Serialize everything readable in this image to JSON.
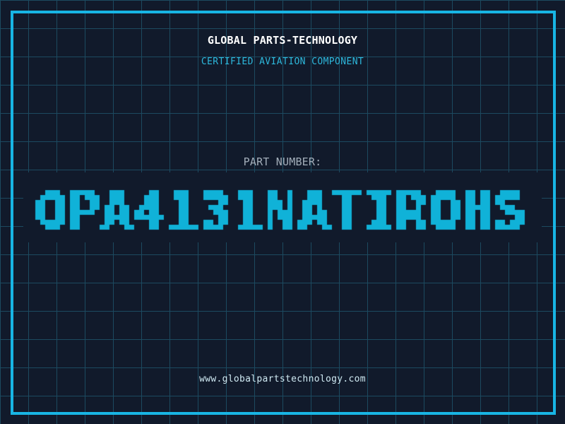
{
  "colors": {
    "background": "#111a2b",
    "grid_line": "#1c4a60",
    "frame": "#18b5e4",
    "title": "#ffffff",
    "subtitle": "#2db8dc",
    "part_label": "#a3aeba",
    "part_number": "#10b2d8",
    "url": "#cfe9f2"
  },
  "header": {
    "title": "GLOBAL PARTS-TECHNOLOGY",
    "subtitle": "CERTIFIED AVIATION COMPONENT"
  },
  "part": {
    "label": "PART NUMBER:",
    "number": "OPA4131NATIROHS"
  },
  "footer": {
    "url": "www.globalpartstechnology.com"
  }
}
